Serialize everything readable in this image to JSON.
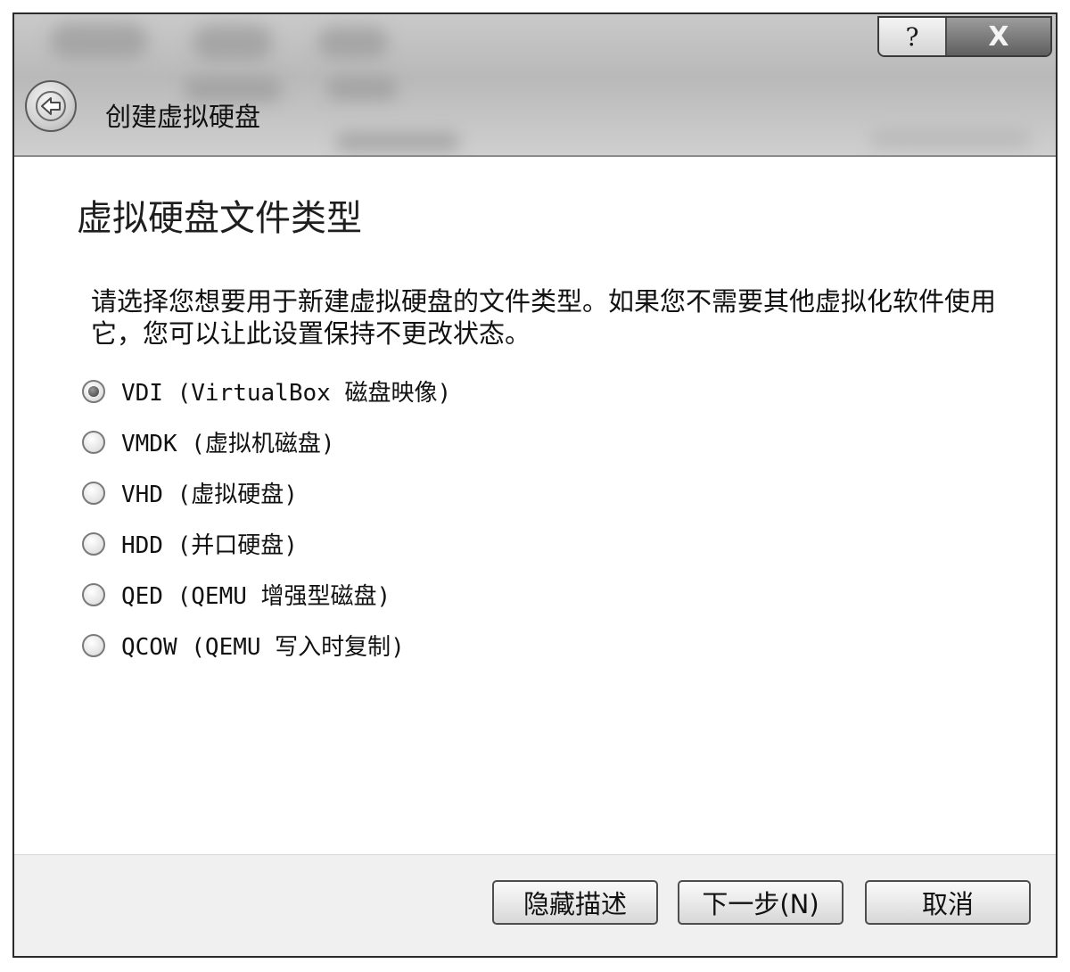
{
  "window": {
    "title": "创建虚拟硬盘",
    "help_label": "?",
    "close_label": "X"
  },
  "page": {
    "title": "虚拟硬盘文件类型",
    "description": "请选择您想要用于新建虚拟硬盘的文件类型。如果您不需要其他虚拟化软件使用它，您可以让此设置保持不更改状态。"
  },
  "options": [
    {
      "label": "VDI (VirtualBox 磁盘映像)",
      "checked": true
    },
    {
      "label": "VMDK (虚拟机磁盘)",
      "checked": false
    },
    {
      "label": "VHD (虚拟硬盘)",
      "checked": false
    },
    {
      "label": "HDD (并口硬盘)",
      "checked": false
    },
    {
      "label": "QED (QEMU 增强型磁盘)",
      "checked": false
    },
    {
      "label": "QCOW (QEMU 写入时复制)",
      "checked": false
    }
  ],
  "buttons": {
    "hide_description": "隐藏描述",
    "next": "下一步(N)",
    "cancel": "取消"
  }
}
